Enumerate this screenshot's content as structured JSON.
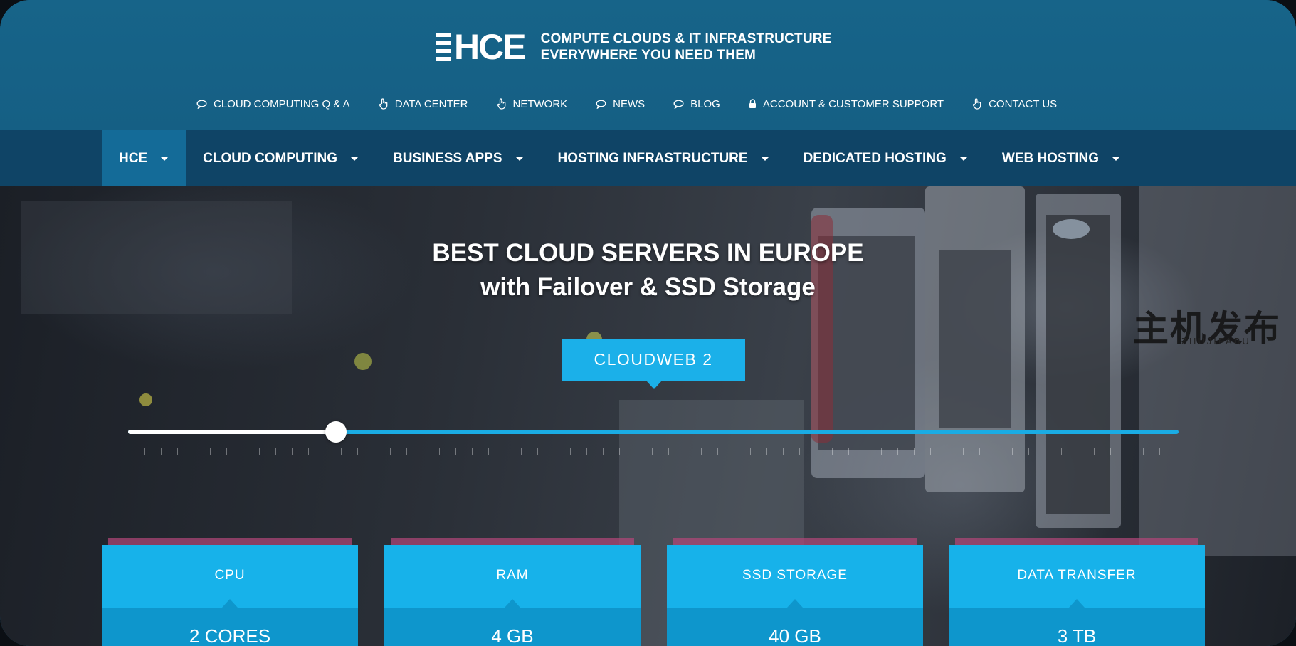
{
  "brand": {
    "logo_text": "HCE",
    "tagline_line1": "COMPUTE CLOUDS & IT INFRASTRUCTURE",
    "tagline_line2": "EVERYWHERE YOU NEED THEM"
  },
  "utility_nav": [
    {
      "label": "CLOUD COMPUTING Q & A",
      "icon": "chat-icon"
    },
    {
      "label": "DATA CENTER",
      "icon": "hand-pointer-icon"
    },
    {
      "label": "NETWORK",
      "icon": "hand-pointer-icon"
    },
    {
      "label": "NEWS",
      "icon": "chat-icon"
    },
    {
      "label": "BLOG",
      "icon": "chat-icon"
    },
    {
      "label": "ACCOUNT & CUSTOMER SUPPORT",
      "icon": "lock-icon"
    },
    {
      "label": "CONTACT US",
      "icon": "hand-pointer-icon"
    }
  ],
  "main_nav": [
    {
      "label": "HCE",
      "active": true
    },
    {
      "label": "CLOUD COMPUTING",
      "active": false
    },
    {
      "label": "BUSINESS APPS",
      "active": false
    },
    {
      "label": "HOSTING INFRASTRUCTURE",
      "active": false
    },
    {
      "label": "DEDICATED HOSTING",
      "active": false
    },
    {
      "label": "WEB HOSTING",
      "active": false
    }
  ],
  "hero": {
    "title_line1": "BEST CLOUD SERVERS IN EUROPE",
    "title_line2": "with Failover & SSD Storage",
    "plan_name": "CLOUDWEB 2",
    "slider_fraction": 0.198,
    "watermark": "主机发布",
    "watermark_sub": "ZHUJIFABU"
  },
  "specs": [
    {
      "label": "CPU",
      "value": "2 CORES"
    },
    {
      "label": "RAM",
      "value": "4 GB"
    },
    {
      "label": "SSD STORAGE",
      "value": "40 GB"
    },
    {
      "label": "DATA TRANSFER",
      "value": "3 TB"
    }
  ],
  "colors": {
    "header_bg": "#176489",
    "nav_bg": "#0f4466",
    "nav_active_bg": "#146b98",
    "accent": "#1bb0e9",
    "spec_value_bg": "#0e96cc"
  }
}
